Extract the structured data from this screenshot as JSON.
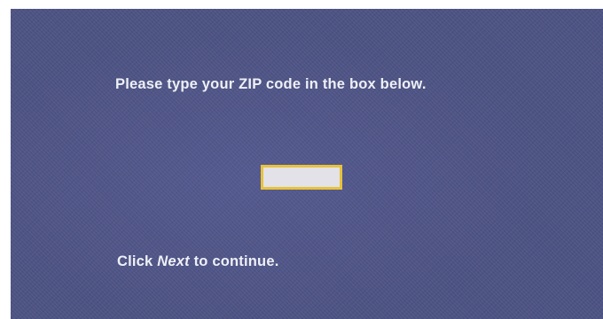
{
  "instructions": {
    "prompt": "Please type your ZIP code in the box below.",
    "continue_prefix": "Click ",
    "continue_keyword": "Next",
    "continue_suffix": " to continue."
  },
  "zip_field": {
    "value": "",
    "placeholder": ""
  },
  "colors": {
    "background": "#4d5383",
    "text": "#eef0f6",
    "input_border": "#e8c23a",
    "input_fill": "#e2e2e8"
  }
}
